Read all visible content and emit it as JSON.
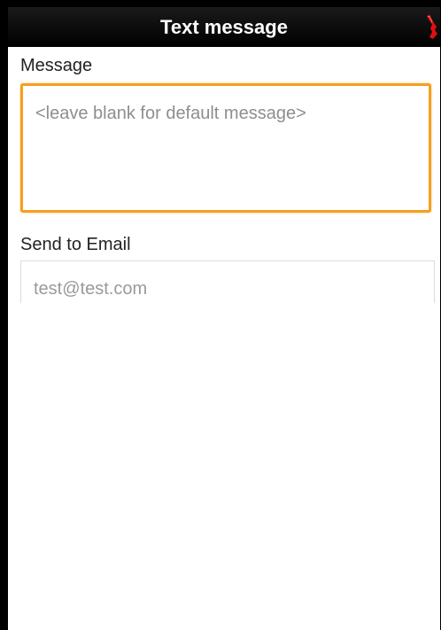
{
  "titlebar": {
    "title": "Text message",
    "icon": "flag-icon",
    "icon_color": "#e01010"
  },
  "form": {
    "message_label": "Message",
    "message_placeholder": "<leave blank for default message>",
    "email_label": "Send to Email",
    "email_placeholder": "test@test.com"
  },
  "colors": {
    "accent_focus": "#f5a020",
    "background": "#ffffff",
    "titlebar": "#000000"
  }
}
